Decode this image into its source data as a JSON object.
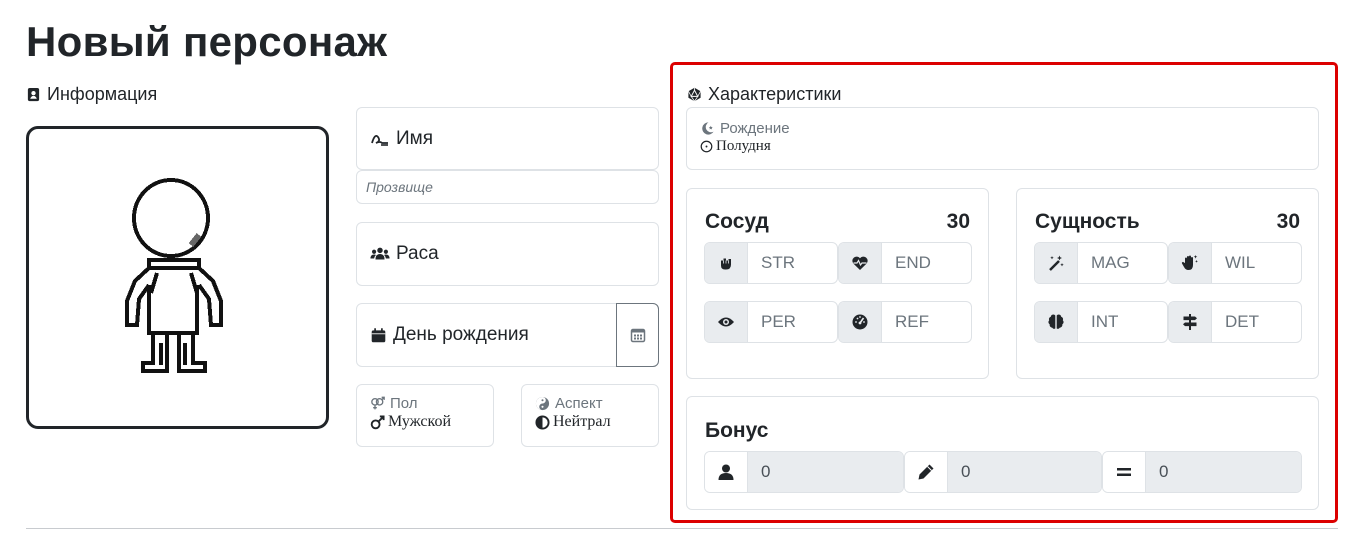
{
  "page": {
    "title": "Новый персонаж"
  },
  "info": {
    "label": "Информация",
    "name_placeholder": "Имя",
    "nickname_placeholder": "Прозвище",
    "race_placeholder": "Раса",
    "birthday_placeholder": "День рождения",
    "gender": {
      "label": "Пол",
      "value": "Мужской"
    },
    "aspect": {
      "label": "Аспект",
      "value": "Нейтрал"
    }
  },
  "stats": {
    "label": "Характеристики",
    "birth": {
      "label": "Рождение",
      "value": "Полудня"
    },
    "vessel": {
      "title": "Сосуд",
      "total": "30",
      "fields": [
        {
          "icon": "fist-icon",
          "label": "STR"
        },
        {
          "icon": "heart-pulse-icon",
          "label": "END"
        },
        {
          "icon": "eye-icon",
          "label": "PER"
        },
        {
          "icon": "gauge-icon",
          "label": "REF"
        }
      ]
    },
    "essence": {
      "title": "Сущность",
      "total": "30",
      "fields": [
        {
          "icon": "magic-wand-icon",
          "label": "MAG"
        },
        {
          "icon": "sparkle-hand-icon",
          "label": "WIL"
        },
        {
          "icon": "brain-icon",
          "label": "INT"
        },
        {
          "icon": "signpost-icon",
          "label": "DET"
        }
      ]
    },
    "bonus": {
      "title": "Бонус",
      "fields": [
        {
          "icon": "user-icon",
          "value": "0"
        },
        {
          "icon": "pencil-icon",
          "value": "0"
        },
        {
          "icon": "equals-icon",
          "value": "0"
        }
      ]
    }
  }
}
